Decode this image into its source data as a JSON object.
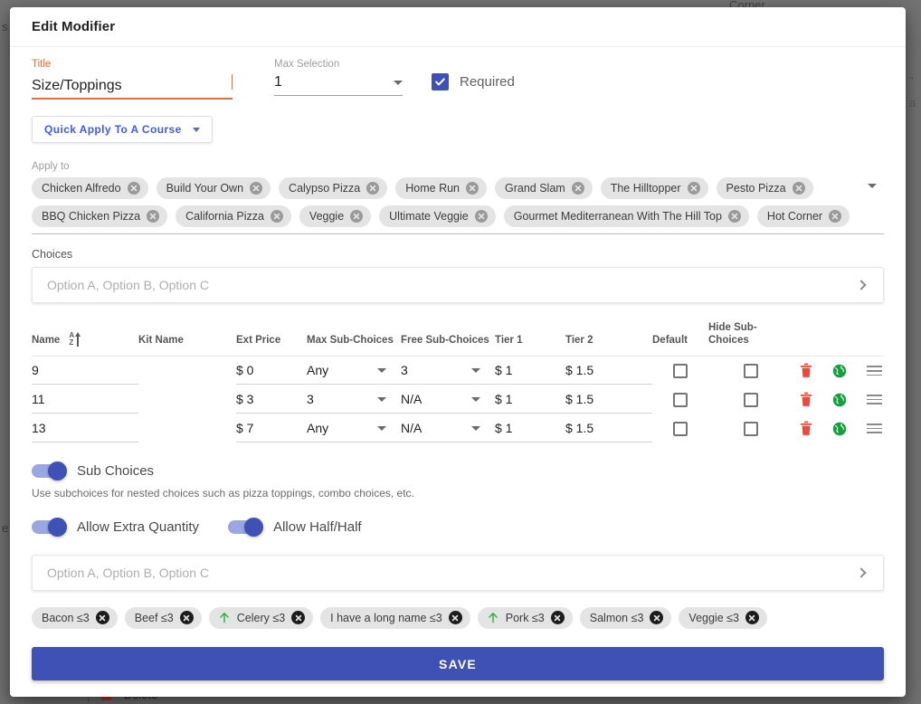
{
  "background": {
    "left_fragment": "s",
    "left_fragment_2": "e",
    "top_right_fragment": "Corner",
    "right_fragment_1": "\"",
    "right_fragment_2": "a",
    "delete_label": "Delete"
  },
  "modal": {
    "title": "Edit Modifier"
  },
  "form": {
    "title_label": "Title",
    "title_value": "Size/Toppings",
    "max_selection_label": "Max Selection",
    "max_selection_value": "1",
    "required_label": "Required",
    "required_checked": true,
    "quick_apply_label": "Quick Apply To A Course"
  },
  "apply_to": {
    "label": "Apply to",
    "chips": [
      "Chicken Alfredo",
      "Build Your Own",
      "Calypso Pizza",
      "Home Run",
      "Grand Slam",
      "The Hilltopper",
      "Pesto Pizza",
      "BBQ Chicken Pizza",
      "California Pizza",
      "Veggie",
      "Ultimate Veggie",
      "Gourmet Mediterranean With The Hill Top",
      "Hot Corner"
    ]
  },
  "choices": {
    "label": "Choices",
    "input_placeholder": "Option A, Option B, Option C",
    "input_value": "",
    "columns": [
      "Name",
      "Kit Name",
      "Ext Price",
      "Max Sub-Choices",
      "Free Sub-Choices",
      "Tier 1",
      "Tier 2",
      "Default",
      "Hide Sub-Choices"
    ],
    "rows": [
      {
        "name": "9",
        "kit_name": "",
        "ext_price": "$ 0",
        "max_sub": "Any",
        "free_sub": "3",
        "tier1": "$ 1",
        "tier2": "$ 1.5",
        "default_checked": false,
        "hide_sub_checked": false
      },
      {
        "name": "11",
        "kit_name": "",
        "ext_price": "$ 3",
        "max_sub": "3",
        "free_sub": "N/A",
        "tier1": "$ 1",
        "tier2": "$ 1.5",
        "default_checked": false,
        "hide_sub_checked": false
      },
      {
        "name": "13",
        "kit_name": "",
        "ext_price": "$ 7",
        "max_sub": "Any",
        "free_sub": "N/A",
        "tier1": "$ 1",
        "tier2": "$ 1.5",
        "default_checked": false,
        "hide_sub_checked": false
      }
    ]
  },
  "toggles": {
    "sub_choices_label": "Sub Choices",
    "sub_choices_on": true,
    "helper_text": "Use subchoices for nested choices such as pizza toppings, combo choices, etc.",
    "allow_extra_quantity_label": "Allow Extra Quantity",
    "allow_extra_quantity_on": true,
    "allow_half_half_label": "Allow Half/Half",
    "allow_half_half_on": true
  },
  "sub_choices": {
    "input_placeholder": "Option A, Option B, Option C",
    "input_value": "",
    "chips": [
      {
        "label": "Bacon ≤3",
        "has_arrow": false
      },
      {
        "label": "Beef ≤3",
        "has_arrow": false
      },
      {
        "label": "Celery ≤3",
        "has_arrow": true
      },
      {
        "label": "I have a long name ≤3",
        "has_arrow": false
      },
      {
        "label": "Pork ≤3",
        "has_arrow": true
      },
      {
        "label": "Salmon ≤3",
        "has_arrow": false
      },
      {
        "label": "Veggie ≤3",
        "has_arrow": false
      }
    ]
  },
  "footer": {
    "save_label": "SAVE"
  },
  "colors": {
    "accent_orange": "#ef6c33",
    "primary_indigo": "#3f51b5",
    "link_blue": "#3d5afe",
    "delete_red": "#f4473b",
    "globe_green": "#14a03c",
    "arrow_green": "#2eb34a"
  }
}
